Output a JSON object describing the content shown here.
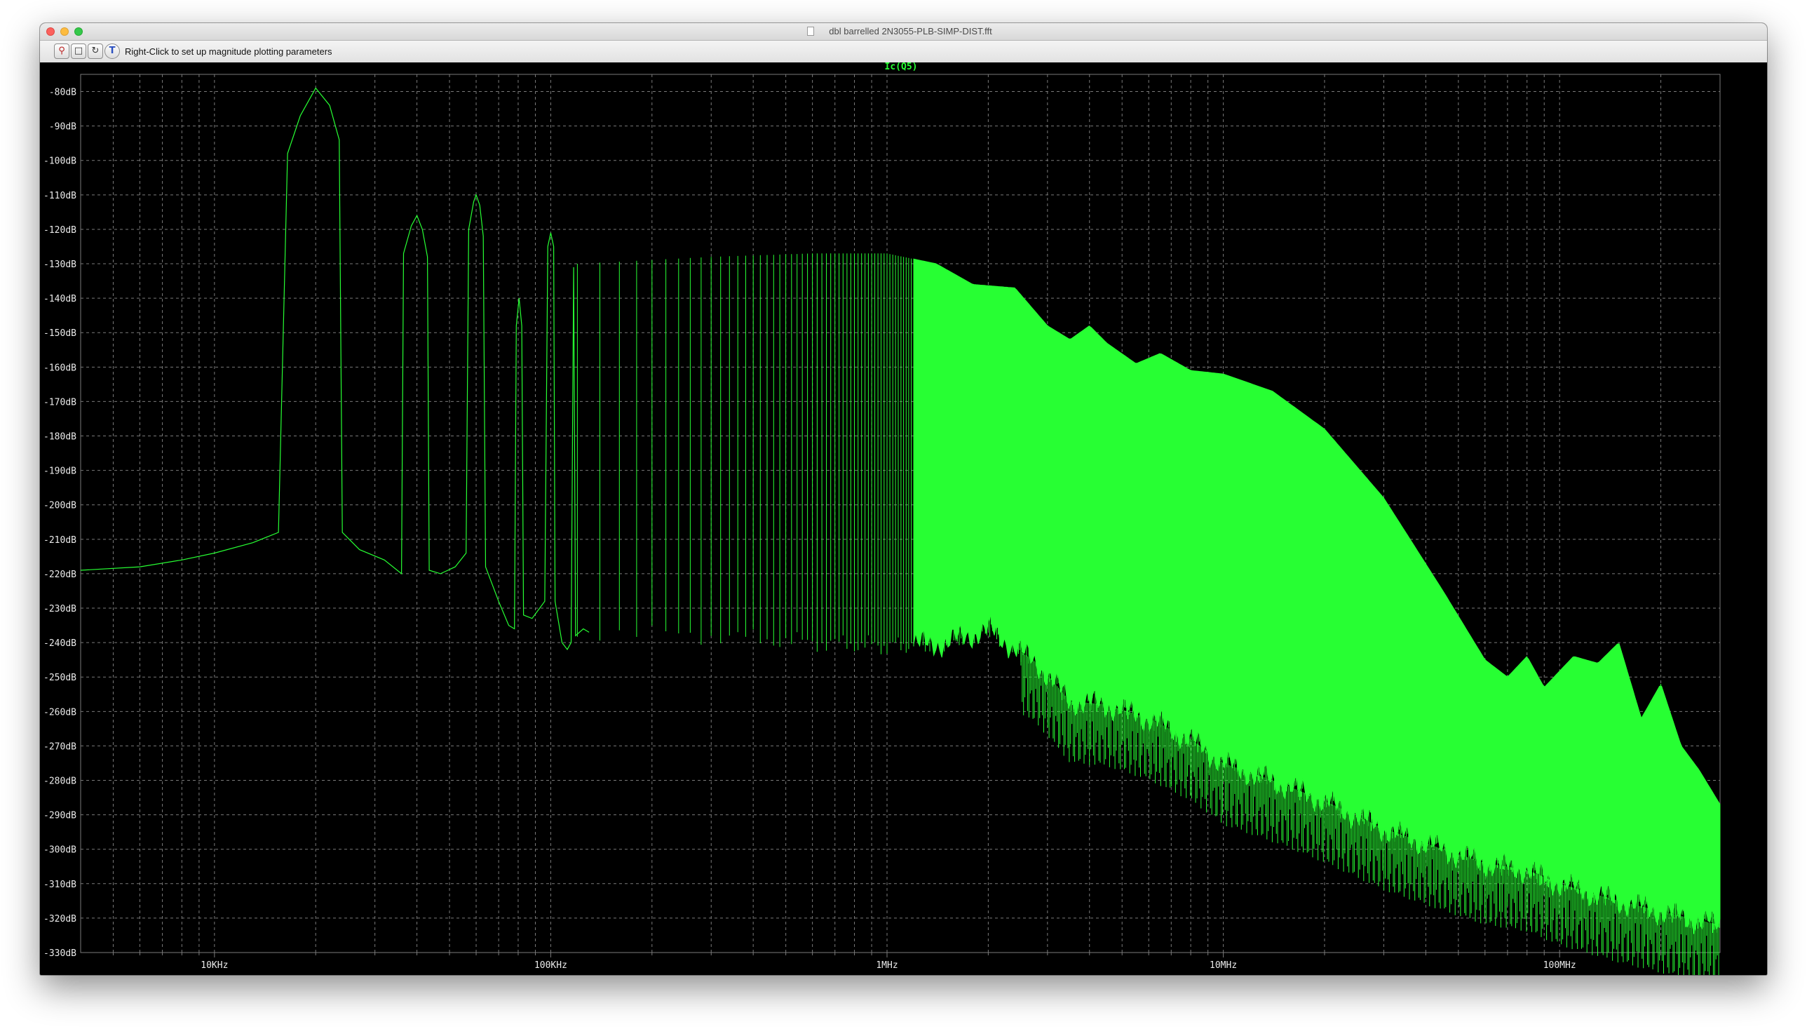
{
  "window": {
    "title": "dbl barrelled 2N3055-PLB-SIMP-DIST.fft"
  },
  "toolbar": {
    "hint": "Right-Click to set up magnitude plotting parameters",
    "tools": [
      {
        "name": "zoom-reset",
        "icon": "zoom-magnifier-icon"
      },
      {
        "name": "fit-axes",
        "icon": "fit-frame-icon"
      },
      {
        "name": "autorange",
        "icon": "autorange-icon"
      },
      {
        "name": "add-text",
        "icon": "text-tool-icon"
      }
    ]
  },
  "colors": {
    "trace": "#27ff33",
    "background": "#000000",
    "grid": "#7a7a7a",
    "axis_text": "#eaeaea"
  },
  "chart_data": {
    "type": "line",
    "title": "Ic(Q5)",
    "xlabel": "",
    "ylabel": "",
    "x_scale": "log",
    "xlim": [
      4000,
      300000000
    ],
    "ylim": [
      -330,
      -75
    ],
    "y_unit": "dB",
    "grid": true,
    "x_tick_labels": [
      "10KHz",
      "100KHz",
      "1MHz",
      "10MHz",
      "100MHz"
    ],
    "x_tick_values": [
      10000,
      100000,
      1000000,
      10000000,
      100000000
    ],
    "y_tick_labels": [
      "-80dB",
      "-90dB",
      "-100dB",
      "-110dB",
      "-120dB",
      "-130dB",
      "-140dB",
      "-150dB",
      "-160dB",
      "-170dB",
      "-180dB",
      "-190dB",
      "-200dB",
      "-210dB",
      "-220dB",
      "-230dB",
      "-240dB",
      "-250dB",
      "-260dB",
      "-270dB",
      "-280dB",
      "-290dB",
      "-300dB",
      "-310dB",
      "-320dB",
      "-330dB"
    ],
    "y_tick_values": [
      -80,
      -90,
      -100,
      -110,
      -120,
      -130,
      -140,
      -150,
      -160,
      -170,
      -180,
      -190,
      -200,
      -210,
      -220,
      -230,
      -240,
      -250,
      -260,
      -270,
      -280,
      -290,
      -300,
      -310,
      -320,
      -330
    ],
    "series": [
      {
        "name": "Ic(Q5)",
        "points": [
          [
            4000,
            -219
          ],
          [
            6000,
            -218
          ],
          [
            8000,
            -216
          ],
          [
            10000,
            -214
          ],
          [
            13000,
            -211
          ],
          [
            15500,
            -208
          ],
          [
            16500,
            -98
          ],
          [
            18000,
            -87
          ],
          [
            20000,
            -79
          ],
          [
            22000,
            -84
          ],
          [
            23500,
            -94
          ],
          [
            24000,
            -208
          ],
          [
            27000,
            -213
          ],
          [
            32000,
            -216
          ],
          [
            36000,
            -220
          ],
          [
            36500,
            -127
          ],
          [
            38500,
            -119
          ],
          [
            40000,
            -116
          ],
          [
            41500,
            -120
          ],
          [
            43000,
            -128
          ],
          [
            43500,
            -219
          ],
          [
            47000,
            -220
          ],
          [
            52000,
            -218
          ],
          [
            56000,
            -214
          ],
          [
            57000,
            -120
          ],
          [
            59000,
            -112
          ],
          [
            60000,
            -110
          ],
          [
            61500,
            -113
          ],
          [
            63000,
            -122
          ],
          [
            64000,
            -218
          ],
          [
            70000,
            -228
          ],
          [
            75000,
            -235
          ],
          [
            78000,
            -236
          ],
          [
            79000,
            -148
          ],
          [
            80500,
            -140
          ],
          [
            82000,
            -148
          ],
          [
            83000,
            -232
          ],
          [
            88000,
            -233
          ],
          [
            96000,
            -228
          ],
          [
            98000,
            -125
          ],
          [
            100000,
            -121
          ],
          [
            102000,
            -125
          ],
          [
            103000,
            -228
          ],
          [
            108000,
            -240
          ],
          [
            112000,
            -242
          ],
          [
            115000,
            -240
          ],
          [
            117000,
            -131
          ],
          [
            118500,
            -238
          ],
          [
            125000,
            -236
          ],
          [
            130000,
            -237
          ]
        ],
        "comb": {
          "f_start": 120000,
          "f_end": 300000000,
          "spacing_hz": 20000,
          "upper_envelope": [
            [
              120000,
              -130
            ],
            [
              300000,
              -128
            ],
            [
              600000,
              -127
            ],
            [
              1000000,
              -127
            ],
            [
              1400000,
              -130
            ],
            [
              1800000,
              -136
            ],
            [
              2400000,
              -137
            ],
            [
              3000000,
              -148
            ],
            [
              3500000,
              -152
            ],
            [
              4000000,
              -148
            ],
            [
              4500000,
              -153
            ],
            [
              5500000,
              -159
            ],
            [
              6500000,
              -156
            ],
            [
              8000000,
              -161
            ],
            [
              10000000,
              -162
            ],
            [
              14000000,
              -167
            ],
            [
              20000000,
              -178
            ],
            [
              30000000,
              -198
            ],
            [
              45000000,
              -225
            ],
            [
              60000000,
              -245
            ],
            [
              70000000,
              -250
            ],
            [
              80000000,
              -244
            ],
            [
              90000000,
              -253
            ],
            [
              110000000,
              -244
            ],
            [
              130000000,
              -246
            ],
            [
              150000000,
              -240
            ],
            [
              175000000,
              -262
            ],
            [
              200000000,
              -252
            ],
            [
              230000000,
              -270
            ],
            [
              260000000,
              -277
            ],
            [
              300000000,
              -287
            ]
          ],
          "lower_envelope": [
            [
              120000,
              -237
            ],
            [
              300000,
              -238
            ],
            [
              600000,
              -240
            ],
            [
              1000000,
              -241
            ],
            [
              1500000,
              -240
            ],
            [
              2000000,
              -236
            ],
            [
              2800000,
              -246
            ],
            [
              3500000,
              -257
            ],
            [
              4500000,
              -258
            ],
            [
              6000000,
              -262
            ],
            [
              8000000,
              -268
            ],
            [
              10000000,
              -275
            ],
            [
              15000000,
              -281
            ],
            [
              20000000,
              -286
            ],
            [
              30000000,
              -294
            ],
            [
              45000000,
              -300
            ],
            [
              60000000,
              -304
            ],
            [
              80000000,
              -306
            ],
            [
              100000000,
              -310
            ],
            [
              150000000,
              -315
            ],
            [
              200000000,
              -318
            ],
            [
              300000000,
              -322
            ]
          ]
        }
      }
    ]
  }
}
